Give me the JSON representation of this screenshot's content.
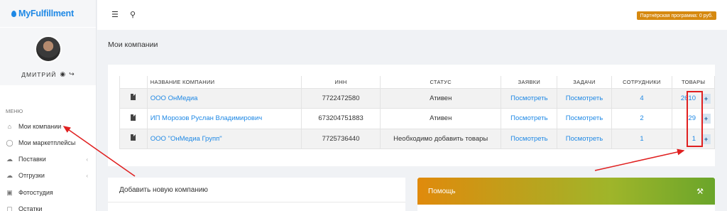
{
  "app": {
    "logo": "MyFulfillment",
    "user_name": "ДМИТРИЙ",
    "partner_program": "Партнёрская программа: 0 руб."
  },
  "sidebar": {
    "menu_label": "МЕНЮ",
    "items": [
      {
        "label": "Мои компании",
        "icon": "home-icon"
      },
      {
        "label": "Мои маркетплейсы",
        "icon": "globe-icon"
      },
      {
        "label": "Поставки",
        "icon": "cloud-upload-icon",
        "has_children": true
      },
      {
        "label": "Отгрузки",
        "icon": "cloud-download-icon",
        "has_children": true
      },
      {
        "label": "Фотостудия",
        "icon": "camera-icon"
      },
      {
        "label": "Остатки",
        "icon": "box-icon"
      }
    ]
  },
  "main": {
    "title": "Мои компании",
    "table": {
      "headers": [
        "НАЗВАНИЕ КОМПАНИИ",
        "ИНН",
        "СТАТУС",
        "ЗАЯВКИ",
        "ЗАДАЧИ",
        "СОТРУДНИКИ",
        "ТОВАРЫ"
      ],
      "rows": [
        {
          "name": "ООО ОнМедиа",
          "inn": "7722472580",
          "status": "Ативен",
          "requests": "Посмотреть",
          "tasks": "Посмотреть",
          "staff": "4",
          "goods": "2610",
          "add": "+"
        },
        {
          "name": "ИП Морозов Руслан Владимирович",
          "inn": "673204751883",
          "status": "Ативен",
          "requests": "Посмотреть",
          "tasks": "Посмотреть",
          "staff": "2",
          "goods": "29",
          "add": "+"
        },
        {
          "name": "ООО \"ОнМедиа Групп\"",
          "inn": "7725736440",
          "status": "Необходимо добавить товары",
          "requests": "Посмотреть",
          "tasks": "Посмотреть",
          "staff": "1",
          "goods": "1",
          "add": "+"
        }
      ]
    },
    "add_company_title": "Добавить новую компанию",
    "help_title": "Помощь"
  },
  "colors": {
    "accent": "#1e88e5",
    "partner_badge": "#d68910",
    "annotation": "#e02020"
  }
}
